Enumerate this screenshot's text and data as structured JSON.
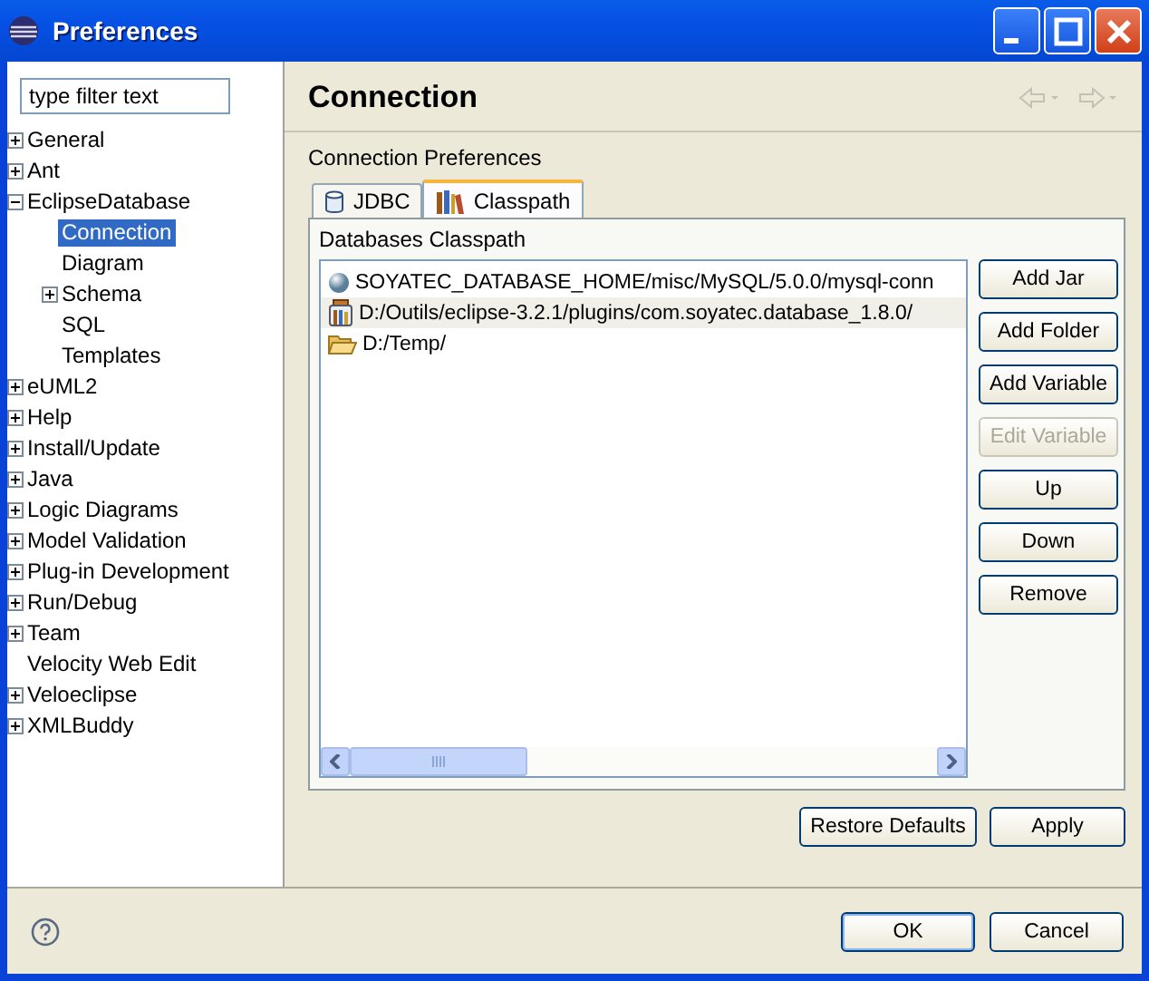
{
  "window": {
    "title": "Preferences"
  },
  "filter": {
    "placeholder": "type filter text"
  },
  "tree": [
    {
      "label": "General",
      "expanded": false,
      "selected": false
    },
    {
      "label": "Ant",
      "expanded": false,
      "selected": false
    },
    {
      "label": "EclipseDatabase",
      "expanded": true,
      "selected": false,
      "children": [
        {
          "label": "Connection",
          "selected": true
        },
        {
          "label": "Diagram",
          "selected": false
        },
        {
          "label": "Schema",
          "expanded": false,
          "selected": false
        },
        {
          "label": "SQL",
          "selected": false
        },
        {
          "label": "Templates",
          "selected": false
        }
      ]
    },
    {
      "label": "eUML2",
      "expanded": false,
      "selected": false
    },
    {
      "label": "Help",
      "expanded": false,
      "selected": false
    },
    {
      "label": "Install/Update",
      "expanded": false,
      "selected": false
    },
    {
      "label": "Java",
      "expanded": false,
      "selected": false
    },
    {
      "label": "Logic Diagrams",
      "expanded": false,
      "selected": false
    },
    {
      "label": "Model Validation",
      "expanded": false,
      "selected": false
    },
    {
      "label": "Plug-in Development",
      "expanded": false,
      "selected": false
    },
    {
      "label": "Run/Debug",
      "expanded": false,
      "selected": false
    },
    {
      "label": "Team",
      "expanded": false,
      "selected": false
    },
    {
      "label": "Velocity Web Edit",
      "selected": false
    },
    {
      "label": "Veloeclipse",
      "expanded": false,
      "selected": false
    },
    {
      "label": "XMLBuddy",
      "expanded": false,
      "selected": false
    }
  ],
  "page": {
    "title": "Connection",
    "subtitle": "Connection Preferences",
    "tabs": [
      {
        "label": "JDBC",
        "kind": "database",
        "selected": false
      },
      {
        "label": "Classpath",
        "kind": "library",
        "selected": true
      }
    ],
    "group_label": "Databases Classpath",
    "entries": [
      {
        "kind": "variable",
        "path": "SOYATEC_DATABASE_HOME/misc/MySQL/5.0.0/mysql-conn",
        "selected": false
      },
      {
        "kind": "jar",
        "path": "D:/Outils/eclipse-3.2.1/plugins/com.soyatec.database_1.8.0/",
        "selected": true
      },
      {
        "kind": "folder",
        "path": "D:/Temp/",
        "selected": false
      }
    ],
    "side_buttons": [
      {
        "label": "Add Jar",
        "disabled": false
      },
      {
        "label": "Add Folder",
        "disabled": false
      },
      {
        "label": "Add Variable",
        "disabled": false
      },
      {
        "label": "Edit Variable",
        "disabled": true
      },
      {
        "label": "Up",
        "disabled": false
      },
      {
        "label": "Down",
        "disabled": false
      },
      {
        "label": "Remove",
        "disabled": false
      }
    ],
    "page_buttons": [
      "Restore Defaults",
      "Apply"
    ]
  },
  "dialog_buttons": [
    "OK",
    "Cancel"
  ]
}
